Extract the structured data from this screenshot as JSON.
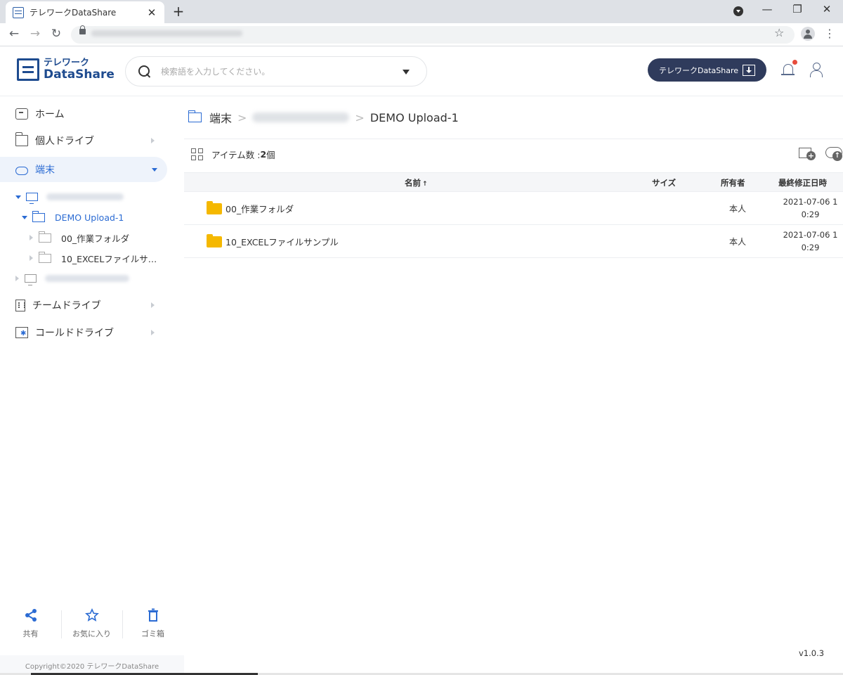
{
  "browser": {
    "tab_title": "テレワークDataShare",
    "tab_close": "✕",
    "new_tab": "+",
    "back": "←",
    "forward": "→",
    "reload": "↻",
    "star": "☆",
    "menu": "⋮",
    "minimize": "—",
    "restore": "❐",
    "close": "✕"
  },
  "header": {
    "logo_top": "テレワーク",
    "logo_bottom": "DataShare",
    "search_placeholder": "検索語を入力してください。",
    "app_button_label": "テレワークDataShare"
  },
  "sidebar": {
    "home": "ホーム",
    "personal_drive": "個人ドライブ",
    "devices": "端末",
    "tree": {
      "upload_folder": "DEMO Upload-1",
      "sub1": "00_作業フォルダ",
      "sub2": "10_EXCELファイルサ…"
    },
    "team_drive": "チームドライブ",
    "cold_drive": "コールドドライブ",
    "tools": {
      "share": "共有",
      "favorites": "お気に入り",
      "trash": "ゴミ箱"
    },
    "copyright": "Copyright©2020 テレワークDataShare"
  },
  "breadcrumb": {
    "root": "端末",
    "current": "DEMO Upload-1"
  },
  "toolbar": {
    "item_count_label": "アイテム数 : ",
    "item_count": "2",
    "item_unit": " 個"
  },
  "table": {
    "columns": {
      "name": "名前",
      "sort_icon": "↑",
      "size": "サイズ",
      "owner": "所有者",
      "modified": "最終修正日時"
    },
    "rows": [
      {
        "name": "00_作業フォルダ",
        "size": "",
        "owner": "本人",
        "date_line1": "2021-07-06 1",
        "date_line2": "0:29"
      },
      {
        "name": "10_EXCELファイルサンプル",
        "size": "",
        "owner": "本人",
        "date_line1": "2021-07-06 1",
        "date_line2": "0:29"
      }
    ]
  },
  "version": "v1.0.3"
}
